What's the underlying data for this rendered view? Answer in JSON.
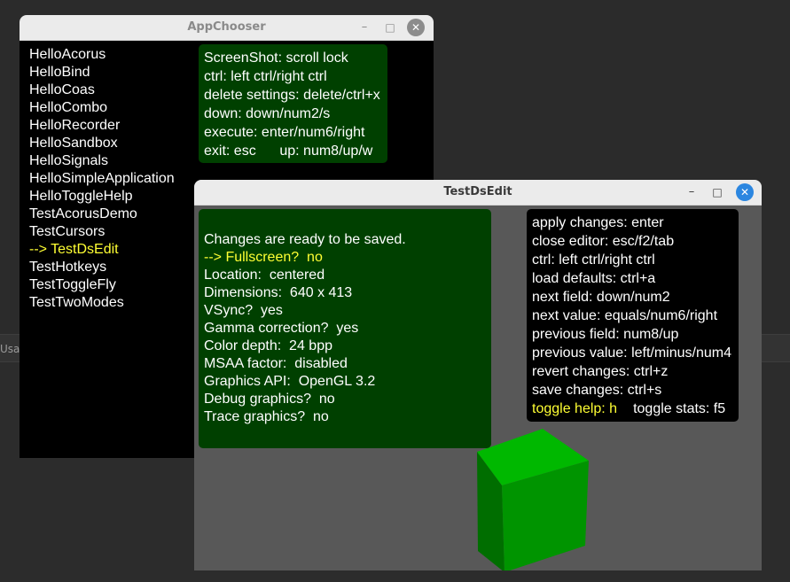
{
  "background": {
    "strip_text": "Usa"
  },
  "appchooser": {
    "title": "AppChooser",
    "minimize_icon": "–",
    "maximize_icon": "□",
    "close_icon": "✕",
    "items": [
      {
        "label": "HelloAcorus"
      },
      {
        "label": "HelloBind"
      },
      {
        "label": "HelloCoas"
      },
      {
        "label": "HelloCombo"
      },
      {
        "label": "HelloRecorder"
      },
      {
        "label": "HelloSandbox"
      },
      {
        "label": "HelloSignals"
      },
      {
        "label": "HelloSimpleApplication"
      },
      {
        "label": "HelloToggleHelp"
      },
      {
        "label": "TestAcorusDemo"
      },
      {
        "label": "TestCursors"
      },
      {
        "label": "--> TestDsEdit"
      },
      {
        "label": "TestHotkeys"
      },
      {
        "label": "TestToggleFly"
      },
      {
        "label": "TestTwoModes"
      }
    ],
    "selected_index": 11,
    "help": [
      "ScreenShot: scroll lock",
      "ctrl: left ctrl/right ctrl",
      "delete settings: delete/ctrl+x",
      "down: down/num2/s",
      "execute: enter/num6/right",
      "exit: esc      up: num8/up/w"
    ]
  },
  "testdsedit": {
    "title": "TestDsEdit",
    "minimize_icon": "–",
    "maximize_icon": "□",
    "close_icon": "✕",
    "settings": [
      "Changes are ready to be saved.",
      "--> Fullscreen?  no",
      "Location:  centered",
      "Dimensions:  640 x 413",
      "VSync?  yes",
      "Gamma correction?  yes",
      "Color depth:  24 bpp",
      "MSAA factor:  disabled",
      "Graphics API:  OpenGL 3.2",
      "Debug graphics?  no",
      "Trace graphics?  no"
    ],
    "selected_setting_index": 1,
    "keys": [
      "apply changes: enter",
      "close editor: esc/f2/tab",
      "ctrl: left ctrl/right ctrl",
      "load defaults: ctrl+a",
      "next field: down/num2",
      "next value: equals/num6/right",
      "previous field: num8/up",
      "previous value: left/minus/num4",
      "revert changes: ctrl+z",
      "save changes: ctrl+s"
    ],
    "toggle_help": "toggle help: h",
    "toggle_stats": "toggle stats: f5",
    "colors": {
      "highlight": "#ffff33",
      "panel_green": "#004000",
      "cube_front": "#009400",
      "cube_top": "#00b800",
      "cube_side": "#006e00",
      "viewport_bg": "#585858"
    }
  }
}
